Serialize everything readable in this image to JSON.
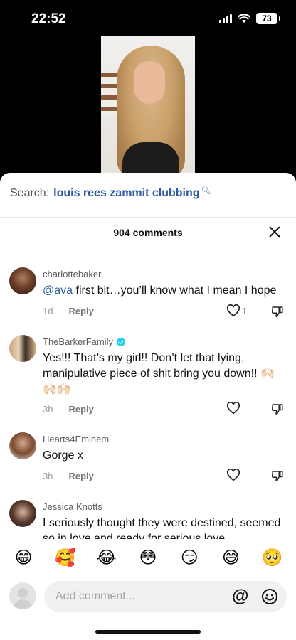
{
  "status_bar": {
    "time": "22:52",
    "battery": "73"
  },
  "search": {
    "label": "Search:",
    "query": "louis rees zammit clubbing"
  },
  "comments_header": {
    "count_label": "904 comments"
  },
  "comments": [
    {
      "username": "charlottebaker",
      "mention": "@ava",
      "text": " first bit…you’ll know what I mean I hope",
      "time": "1d",
      "reply": "Reply",
      "likes": "1",
      "verified": false
    },
    {
      "username": "TheBarkerFamily",
      "text": "Yes!!! That’s my girl!! Don’t let that lying, manipulative piece of shit bring you down!! 🙌🏻🙌🏻🙌🏻",
      "time": "3h",
      "reply": "Reply",
      "likes": "",
      "verified": true
    },
    {
      "username": "Hearts4Eminem",
      "text": "Gorge x",
      "time": "3h",
      "reply": "Reply",
      "likes": "",
      "verified": false
    },
    {
      "username": "Jessica Knotts",
      "text": "I seriously thought they were destined, seemed so in love and ready for serious love",
      "time": "",
      "reply": "",
      "likes": "",
      "verified": false
    }
  ],
  "emoji_bar": [
    "😁",
    "🥰",
    "😂",
    "😳",
    "😏",
    "😅",
    "🥺"
  ],
  "input": {
    "placeholder": "Add comment..."
  },
  "colors": {
    "mention": "#2b5b9e",
    "verified": "#20d5ec"
  }
}
